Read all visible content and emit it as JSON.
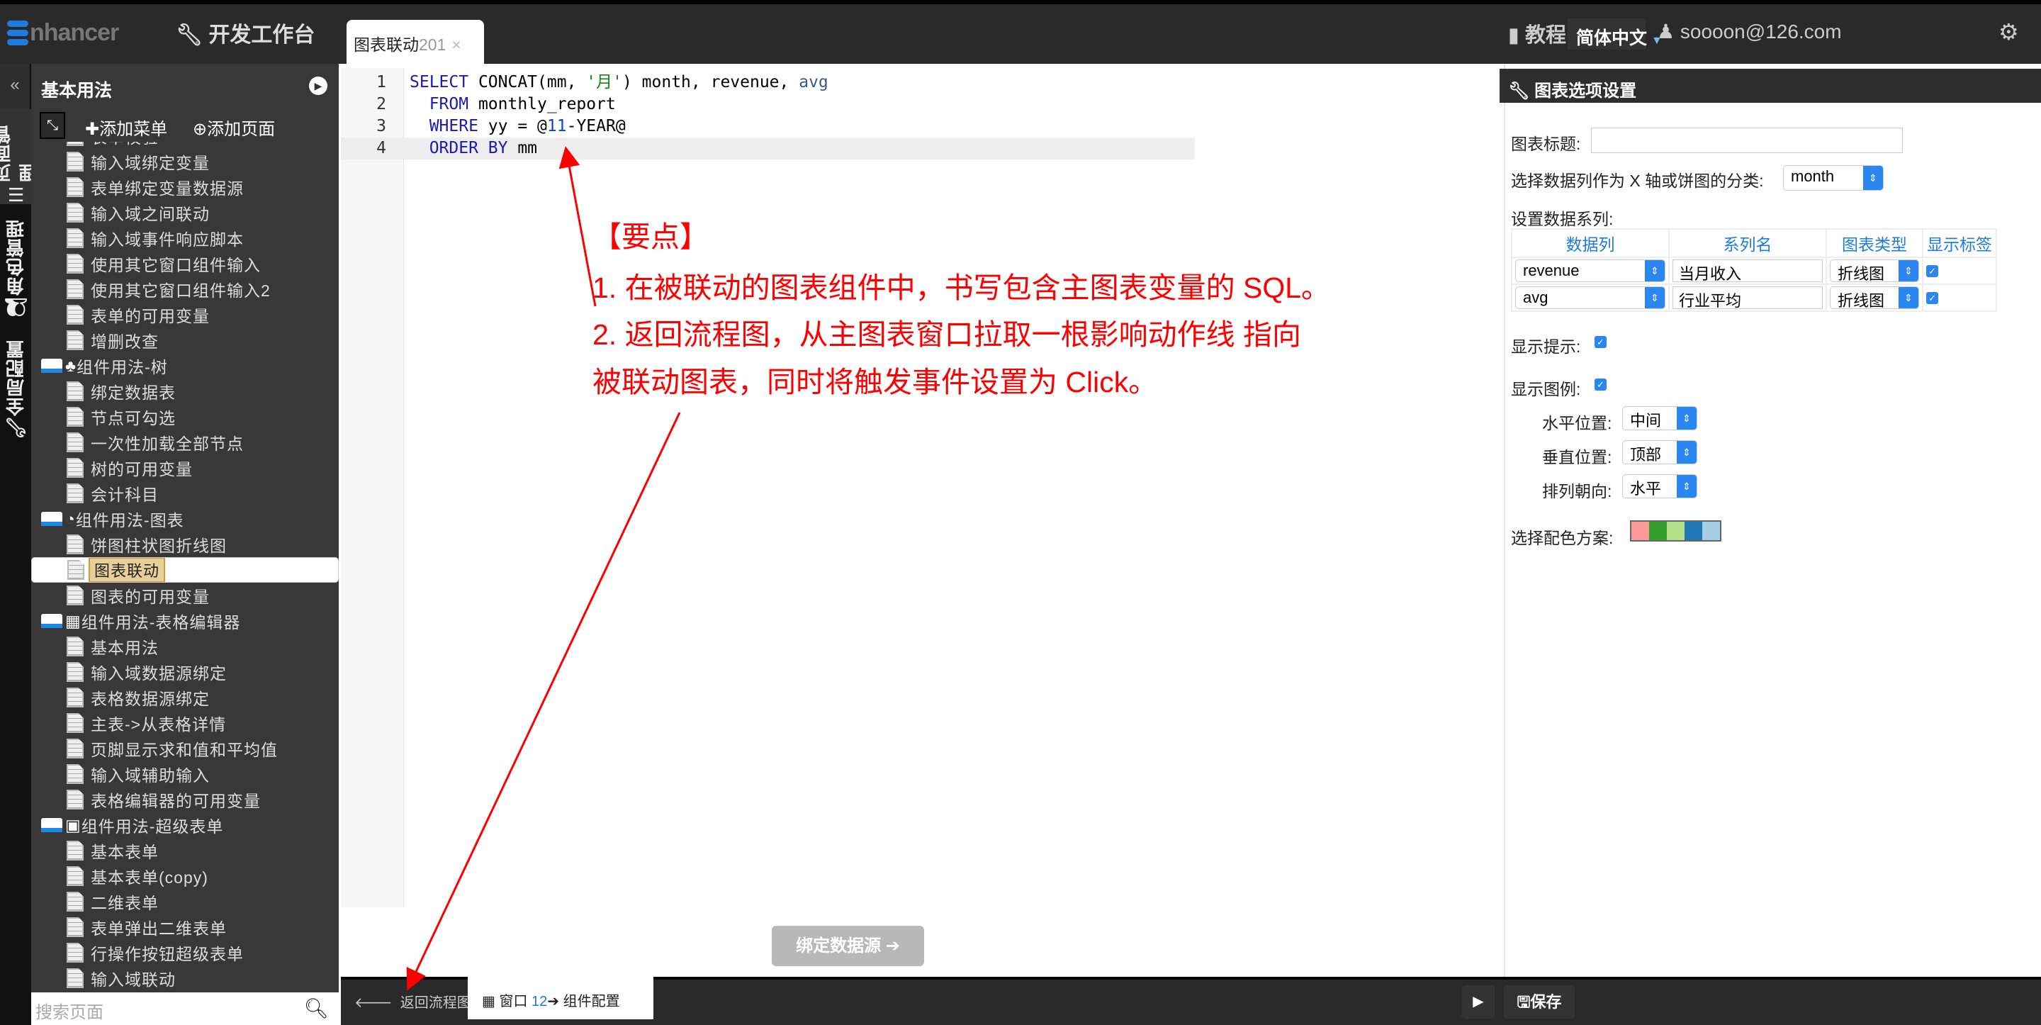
{
  "topbar": {
    "logo": "nhancer",
    "dev_console": "开发工作台",
    "tab_label": "图表联动",
    "tab_num": "201",
    "tab_close": "×",
    "tutorial": "教程",
    "language": "简体中文",
    "user": "soooon@126.com"
  },
  "vtabs": {
    "collapse": "«",
    "page_mgmt": "页面管理",
    "role_mgmt": "角色管理",
    "global_cfg": "全局配置"
  },
  "sidebar": {
    "title": "基本用法",
    "add_menu": "添加菜单",
    "add_page": "添加页面",
    "search_placeholder": "搜索页面",
    "items": [
      {
        "type": "leaf",
        "label": "表单校验"
      },
      {
        "type": "leaf",
        "label": "输入域绑定变量"
      },
      {
        "type": "leaf",
        "label": "表单绑定变量数据源"
      },
      {
        "type": "leaf",
        "label": "输入域之间联动"
      },
      {
        "type": "leaf",
        "label": "输入域事件响应脚本"
      },
      {
        "type": "leaf",
        "label": "使用其它窗口组件输入"
      },
      {
        "type": "leaf",
        "label": "使用其它窗口组件输入2"
      },
      {
        "type": "leaf",
        "label": "表单的可用变量"
      },
      {
        "type": "leaf",
        "label": "增删改查"
      },
      {
        "type": "folder",
        "icon": "tree-icon",
        "glyph": "♣",
        "label": "组件用法-树"
      },
      {
        "type": "leaf",
        "label": "绑定数据表"
      },
      {
        "type": "leaf",
        "label": "节点可勾选"
      },
      {
        "type": "leaf",
        "label": "一次性加载全部节点"
      },
      {
        "type": "leaf",
        "label": "树的可用变量"
      },
      {
        "type": "leaf",
        "label": "会计科目"
      },
      {
        "type": "folder",
        "icon": "pie-chart-icon",
        "glyph": "◔",
        "label": "组件用法-图表"
      },
      {
        "type": "leaf",
        "label": "饼图柱状图折线图"
      },
      {
        "type": "leaf",
        "label": "图表联动",
        "selected": true
      },
      {
        "type": "leaf",
        "label": "图表的可用变量"
      },
      {
        "type": "folder",
        "icon": "grid-icon",
        "glyph": "▦",
        "label": "组件用法-表格编辑器"
      },
      {
        "type": "leaf",
        "label": "基本用法"
      },
      {
        "type": "leaf",
        "label": "输入域数据源绑定"
      },
      {
        "type": "leaf",
        "label": "表格数据源绑定"
      },
      {
        "type": "leaf",
        "label": "主表->从表格详情"
      },
      {
        "type": "leaf",
        "label": "页脚显示求和值和平均值"
      },
      {
        "type": "leaf",
        "label": "输入域辅助输入"
      },
      {
        "type": "leaf",
        "label": "表格编辑器的可用变量"
      },
      {
        "type": "folder",
        "icon": "form-icon",
        "glyph": "▣",
        "label": "组件用法-超级表单"
      },
      {
        "type": "leaf",
        "label": "基本表单"
      },
      {
        "type": "leaf",
        "label": "基本表单(copy)"
      },
      {
        "type": "leaf",
        "label": "二维表单"
      },
      {
        "type": "leaf",
        "label": "表单弹出二维表单"
      },
      {
        "type": "leaf",
        "label": "行操作按钮超级表单"
      },
      {
        "type": "leaf",
        "label": "输入域联动"
      }
    ]
  },
  "editor": {
    "lines": [
      {
        "n": "1",
        "html": "<span class=\"kw\">SELECT</span> CONCAT(mm, <span class=\"str\">'月'</span>) month, revenue, <span class=\"var\">avg</span>"
      },
      {
        "n": "2",
        "html": "  <span class=\"kw\">FROM</span> monthly_report"
      },
      {
        "n": "3",
        "html": "  <span class=\"kw\">WHERE</span> yy = @<span class=\"num\">11</span>-YEAR@"
      },
      {
        "n": "4",
        "html": "  <span class=\"kw\">ORDER BY</span> mm"
      }
    ],
    "bind_button": "绑定数据源 ➔"
  },
  "annotation": {
    "title": "【要点】",
    "line1": "1. 在被联动的图表组件中，书写包含主图表变量的 SQL。",
    "line2": "2. 返回流程图，从主图表窗口拉取一根影响动作线 指向",
    "line3": "被联动图表，同时将触发事件设置为 Click。",
    "color": "#ff0000"
  },
  "panel": {
    "title": "图表选项设置",
    "chart_title_label": "图表标题:",
    "chart_title_value": "",
    "xaxis_label": "选择数据列作为 X 轴或饼图的分类:",
    "xaxis_value": "month",
    "series_label": "设置数据系列:",
    "series_headers": [
      "数据列",
      "系列名",
      "图表类型",
      "显示标签"
    ],
    "series": [
      {
        "column": "revenue",
        "name": "当月收入",
        "type": "折线图",
        "show_label": true
      },
      {
        "column": "avg",
        "name": "行业平均",
        "type": "折线图",
        "show_label": true
      }
    ],
    "show_tooltip_label": "显示提示:",
    "show_tooltip": true,
    "show_legend_label": "显示图例:",
    "show_legend": true,
    "h_pos_label": "水平位置:",
    "h_pos": "中间",
    "v_pos_label": "垂直位置:",
    "v_pos": "顶部",
    "orient_label": "排列朝向:",
    "orient": "水平",
    "palette_label": "选择配色方案:",
    "palette": [
      "#fb9a99",
      "#33a02c",
      "#b2df8a",
      "#1f78b4",
      "#a6cee3"
    ]
  },
  "bottombar": {
    "back": "返回流程图",
    "window": "窗口",
    "window_num": "12",
    "component": "组件配置",
    "save": "保存"
  }
}
